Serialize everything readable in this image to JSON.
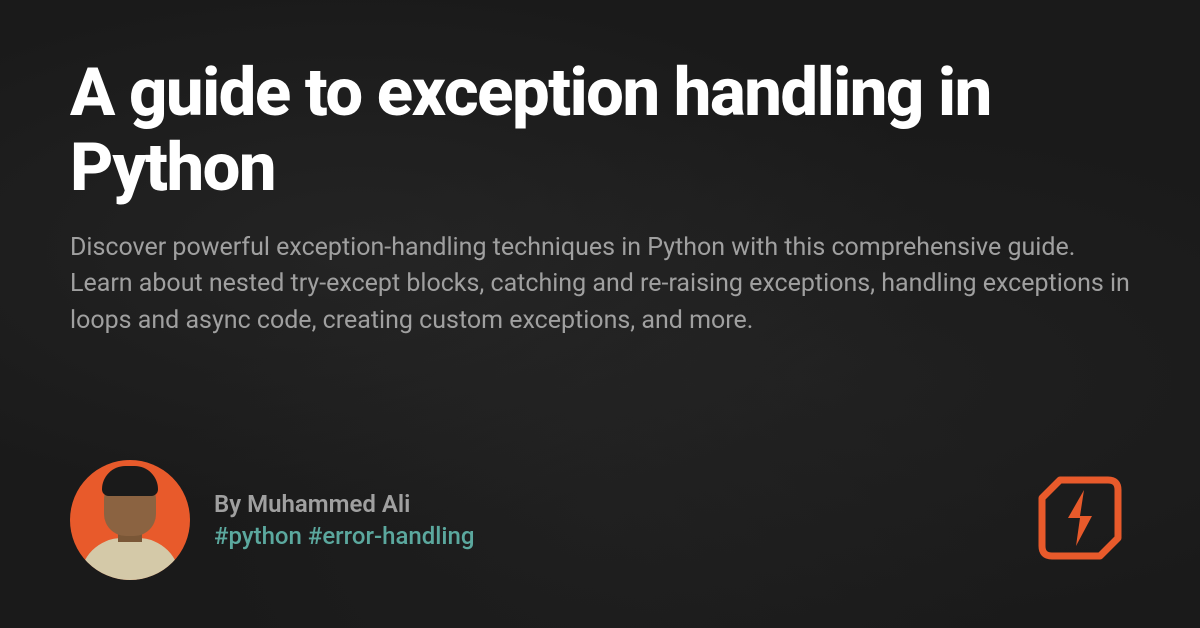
{
  "title": "A guide to exception handling in Python",
  "description": "Discover powerful exception-handling techniques in Python with this comprehensive guide. Learn about nested try-except blocks, catching and re-raising exceptions, handling exceptions in loops and async code, creating custom exceptions, and more.",
  "author": {
    "byline": "By Muhammed Ali",
    "tags": "#python #error-handling"
  }
}
